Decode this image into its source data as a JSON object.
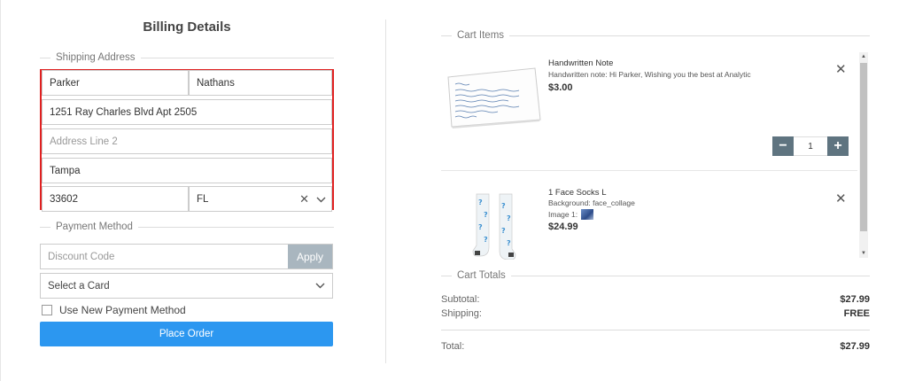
{
  "billing": {
    "title": "Billing Details",
    "shipping_legend": "Shipping Address",
    "first_name": "Parker",
    "last_name": "Nathans",
    "address1": "1251 Ray Charles Blvd Apt 2505",
    "address2_placeholder": "Address Line 2",
    "city": "Tampa",
    "zip": "33602",
    "state": "FL",
    "payment_legend": "Payment Method",
    "discount_placeholder": "Discount Code",
    "apply_label": "Apply",
    "card_select": "Select a Card",
    "new_payment_label": "Use New Payment Method",
    "place_order_label": "Place Order"
  },
  "cart": {
    "items_legend": "Cart Items",
    "items": [
      {
        "name": "Handwritten Note",
        "detail": "Handwritten note: Hi Parker, Wishing you the best at Analytic Aim",
        "price": "$3.00",
        "quantity": "1"
      },
      {
        "name": "1 Face Socks L",
        "background": "Background: face_collage",
        "image_label": "Image 1:",
        "price": "$24.99"
      }
    ],
    "totals_legend": "Cart Totals",
    "subtotal_label": "Subtotal:",
    "subtotal_value": "$27.99",
    "shipping_label": "Shipping:",
    "shipping_value": "FREE",
    "total_label": "Total:",
    "total_value": "$27.99"
  },
  "colors": {
    "accent": "#2c97f0",
    "highlight_border": "#e02020",
    "qty_button": "#5f7480",
    "apply_button": "#a9b6bf"
  },
  "icons": {
    "remove": "close-icon",
    "select": "chevron-down-icon",
    "clear": "close-icon",
    "qty_minus": "minus-icon",
    "qty_plus": "plus-icon"
  }
}
